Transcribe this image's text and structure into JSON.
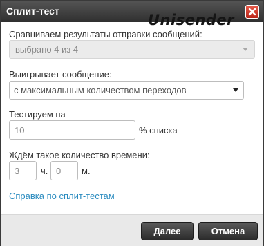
{
  "dialog": {
    "title": "Сплит-тест",
    "brand": "Unisender"
  },
  "compare": {
    "label": "Сравниваем результаты отправки сообщений:",
    "value": "выбрано 4 из 4"
  },
  "winner": {
    "label": "Выигрывает сообщение:",
    "value": "с максимальным количеством переходов"
  },
  "test_on": {
    "label": "Тестируем на",
    "value": "10",
    "unit": "% списка"
  },
  "wait": {
    "label": "Ждём такое количество времени:",
    "hours_value": "3",
    "hours_unit": "ч.",
    "minutes_value": "0",
    "minutes_unit": "м."
  },
  "help_link": "Справка по сплит-тестам",
  "buttons": {
    "next": "Далее",
    "cancel": "Отмена"
  }
}
